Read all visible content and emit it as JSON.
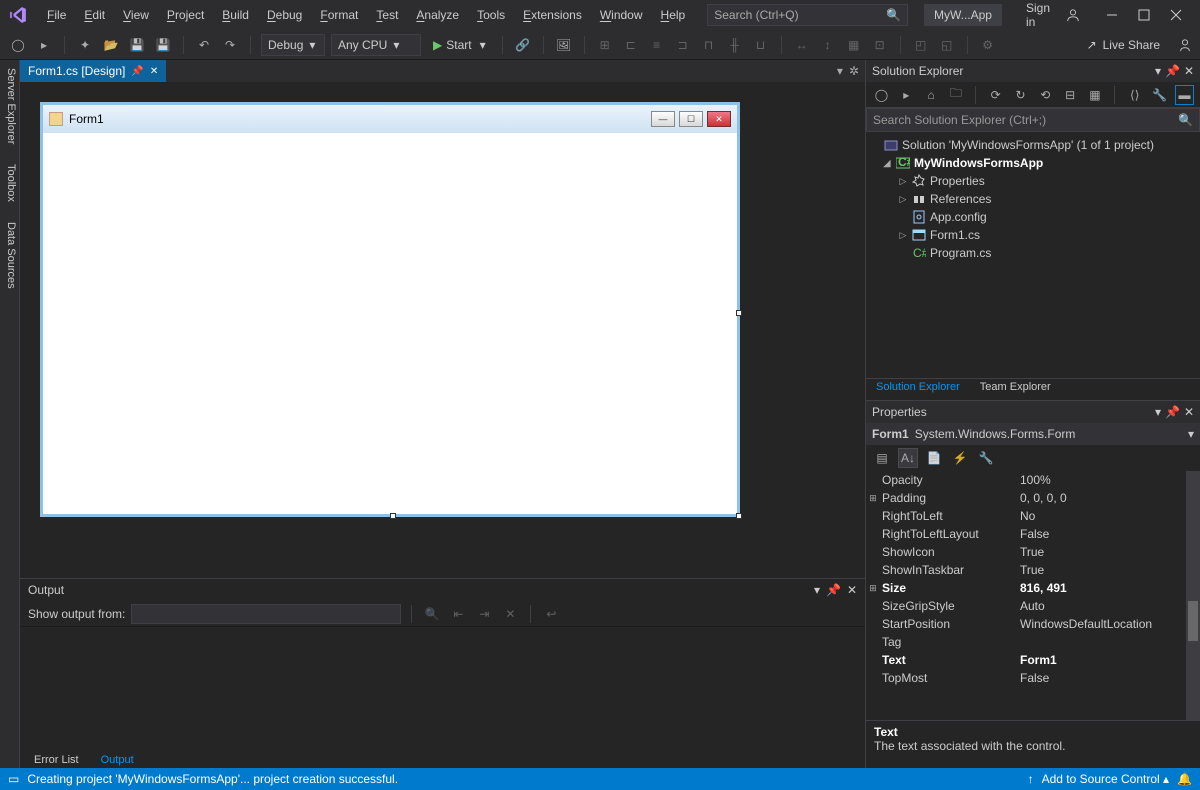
{
  "titlebar": {
    "menu": [
      "File",
      "Edit",
      "View",
      "Project",
      "Build",
      "Debug",
      "Format",
      "Test",
      "Analyze",
      "Tools",
      "Extensions",
      "Window",
      "Help"
    ],
    "search_placeholder": "Search (Ctrl+Q)",
    "app_name": "MyW...App",
    "signin": "Sign in"
  },
  "toolbar": {
    "config": "Debug",
    "platform": "Any CPU",
    "start": "Start",
    "liveshare": "Live Share"
  },
  "sidebar_tabs": [
    "Server Explorer",
    "Toolbox",
    "Data Sources"
  ],
  "doc_tab": {
    "label": "Form1.cs [Design]"
  },
  "designer": {
    "form_title": "Form1"
  },
  "output": {
    "title": "Output",
    "show_from": "Show output from:",
    "tabs": [
      "Error List",
      "Output"
    ],
    "active_tab": 1
  },
  "solution_explorer": {
    "title": "Solution Explorer",
    "search_placeholder": "Search Solution Explorer (Ctrl+;)",
    "root": "Solution 'MyWindowsFormsApp' (1 of 1 project)",
    "project": "MyWindowsFormsApp",
    "nodes": [
      "Properties",
      "References",
      "App.config",
      "Form1.cs",
      "Program.cs"
    ],
    "tabs": [
      "Solution Explorer",
      "Team Explorer"
    ]
  },
  "properties": {
    "title": "Properties",
    "object": "Form1",
    "type": "System.Windows.Forms.Form",
    "rows": [
      {
        "exp": "",
        "name": "Opacity",
        "val": "100%"
      },
      {
        "exp": "⊞",
        "name": "Padding",
        "val": "0, 0, 0, 0"
      },
      {
        "exp": "",
        "name": "RightToLeft",
        "val": "No"
      },
      {
        "exp": "",
        "name": "RightToLeftLayout",
        "val": "False"
      },
      {
        "exp": "",
        "name": "ShowIcon",
        "val": "True"
      },
      {
        "exp": "",
        "name": "ShowInTaskbar",
        "val": "True"
      },
      {
        "exp": "⊞",
        "name": "Size",
        "val": "816, 491",
        "bold": true
      },
      {
        "exp": "",
        "name": "SizeGripStyle",
        "val": "Auto"
      },
      {
        "exp": "",
        "name": "StartPosition",
        "val": "WindowsDefaultLocation"
      },
      {
        "exp": "",
        "name": "Tag",
        "val": ""
      },
      {
        "exp": "",
        "name": "Text",
        "val": "Form1",
        "bold": true
      },
      {
        "exp": "",
        "name": "TopMost",
        "val": "False"
      }
    ],
    "help_name": "Text",
    "help_desc": "The text associated with the control."
  },
  "statusbar": {
    "msg": "Creating project 'MyWindowsFormsApp'... project creation successful.",
    "source_control": "Add to Source Control"
  }
}
